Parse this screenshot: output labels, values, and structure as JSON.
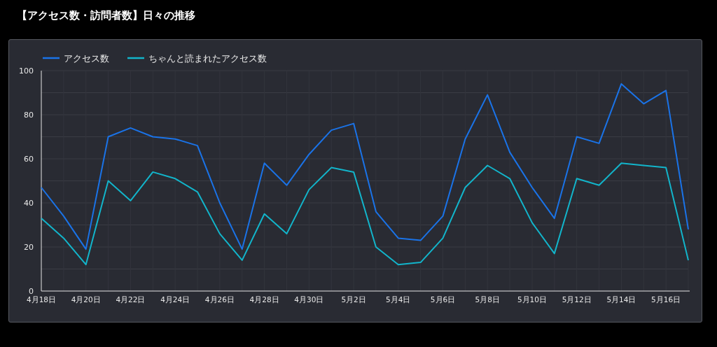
{
  "title": "【アクセス数・訪問者数】日々の推移",
  "chart_data": {
    "type": "line",
    "categories": [
      "4月18日",
      null,
      "4月20日",
      null,
      "4月22日",
      null,
      "4月24日",
      null,
      "4月26日",
      null,
      "4月28日",
      null,
      "4月30日",
      null,
      "5月2日",
      null,
      "5月4日",
      null,
      "5月6日",
      null,
      "5月8日",
      null,
      "5月10日",
      null,
      "5月12日",
      null,
      "5月14日",
      null,
      "5月16日",
      null
    ],
    "series": [
      {
        "name": "アクセス数",
        "color": "#1a73e8",
        "values": [
          47,
          34,
          19,
          70,
          74,
          70,
          69,
          66,
          40,
          19,
          58,
          48,
          62,
          73,
          76,
          36,
          24,
          23,
          34,
          69,
          89,
          63,
          47,
          33,
          70,
          67,
          94,
          85,
          91,
          28
        ]
      },
      {
        "name": "ちゃんと読まれたアクセス数",
        "color": "#12b5cb",
        "values": [
          33,
          24,
          12,
          50,
          41,
          54,
          51,
          45,
          26,
          14,
          35,
          26,
          46,
          56,
          54,
          20,
          12,
          13,
          24,
          47,
          57,
          51,
          31,
          17,
          51,
          48,
          58,
          57,
          56,
          14
        ]
      }
    ],
    "ylim": [
      0,
      100
    ],
    "grid": true,
    "legend": "top",
    "yticks": [
      0,
      20,
      40,
      60,
      80,
      100
    ]
  }
}
